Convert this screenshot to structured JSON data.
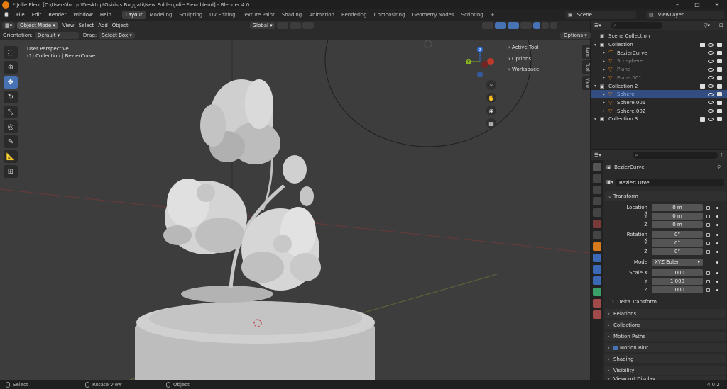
{
  "window": {
    "title": "* Jolie Fleur [C:\\Users\\locqu\\Desktop\\Osiris's Buggati\\New Folder\\Jolie Fleur.blend] - Blender 4.0",
    "controls": [
      "–",
      "□",
      "✕"
    ]
  },
  "menu": {
    "items": [
      "File",
      "Edit",
      "Render",
      "Window",
      "Help"
    ],
    "workspaces": [
      "Layout",
      "Modeling",
      "Sculpting",
      "UV Editing",
      "Texture Paint",
      "Shading",
      "Animation",
      "Rendering",
      "Compositing",
      "Geometry Nodes",
      "Scripting",
      "+"
    ],
    "active_workspace": "Layout",
    "scene": "Scene",
    "view_layer": "ViewLayer"
  },
  "viewport_header": {
    "mode": "Object Mode",
    "menus": [
      "View",
      "Select",
      "Add",
      "Object"
    ],
    "transform": "Global",
    "orientation_label": "Orientation:",
    "orientation_value": "Default",
    "drag_label": "Drag:",
    "drag_value": "Select Box",
    "options": "Options"
  },
  "viewport": {
    "perspective": "User Perspective",
    "collection_info": "(1) Collection | BezierCurve",
    "side_tabs": [
      "Item",
      "Tool",
      "View"
    ],
    "tool_panels": [
      "Active Tool",
      "Options",
      "Workspace"
    ],
    "gizmo_axes": [
      "Z",
      "Y",
      "X"
    ]
  },
  "outliner": {
    "root": "Scene Collection",
    "rows": [
      {
        "label": "Collection",
        "indent": 1,
        "type": "collection",
        "dim": false,
        "selected": false
      },
      {
        "label": "BezierCurve",
        "indent": 2,
        "type": "curve",
        "dim": false,
        "selected": false
      },
      {
        "label": "Scosphere",
        "indent": 2,
        "type": "mesh",
        "dim": true,
        "selected": false
      },
      {
        "label": "Plane",
        "indent": 2,
        "type": "mesh",
        "dim": true,
        "selected": false
      },
      {
        "label": "Plane.001",
        "indent": 2,
        "type": "mesh",
        "dim": true,
        "selected": false
      },
      {
        "label": "Collection 2",
        "indent": 1,
        "type": "collection",
        "dim": false,
        "selected": false
      },
      {
        "label": "Sphere",
        "indent": 2,
        "type": "mesh",
        "dim": false,
        "selected": true
      },
      {
        "label": "Sphere.001",
        "indent": 2,
        "type": "mesh",
        "dim": false,
        "selected": false
      },
      {
        "label": "Sphere.002",
        "indent": 2,
        "type": "mesh",
        "dim": false,
        "selected": false
      },
      {
        "label": "Collection 3",
        "indent": 1,
        "type": "collection",
        "dim": false,
        "selected": false
      }
    ]
  },
  "properties": {
    "object_name": "BezierCurve",
    "data_name": "BezierCurve",
    "transform_title": "Transform",
    "location_label": "Location X",
    "location": [
      "0 m",
      "0 m",
      "0 m"
    ],
    "rotation_label": "Rotation X",
    "rotation": [
      "0°",
      "0°",
      "0°"
    ],
    "axis_y": "Y",
    "axis_z": "Z",
    "mode_label": "Mode",
    "mode_value": "XYZ Euler",
    "scale_label": "Scale X",
    "scale": [
      "1.000",
      "1.000",
      "1.000"
    ],
    "delta": "Delta Transform",
    "panels": [
      "Relations",
      "Collections",
      "Motion Paths",
      "Motion Blur",
      "Shading",
      "Visibility",
      "Viewport Display"
    ]
  },
  "status": {
    "select": "Select",
    "rotate": "Rotate View",
    "object": "Object",
    "version": "4.0.2"
  },
  "colors": {
    "accent": "#4772b3",
    "viewport_bg": "#3d3d3d",
    "orange": "#e87d0d"
  }
}
